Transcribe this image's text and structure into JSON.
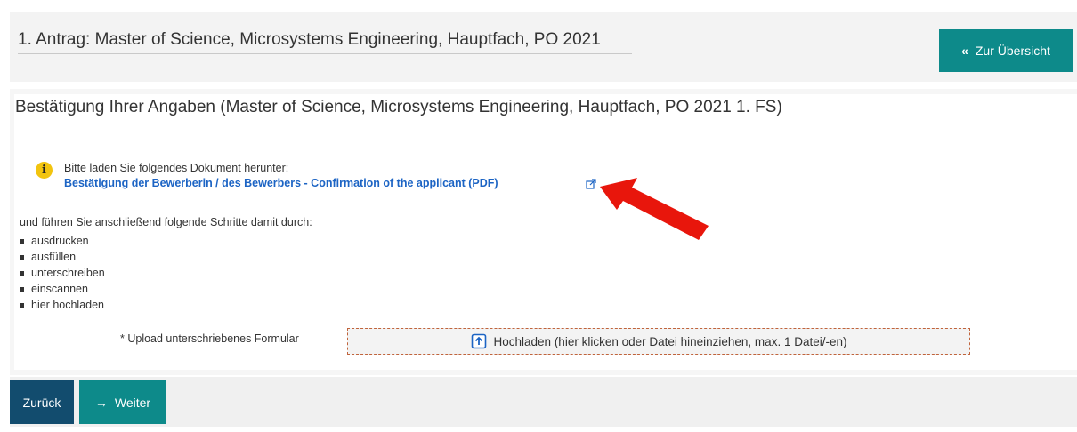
{
  "header": {
    "title": "1. Antrag: Master of Science, Microsystems Engineering, Hauptfach, PO 2021",
    "overview_button": "Zur Übersicht",
    "overview_icon": "«"
  },
  "section": {
    "title": "Bestätigung Ihrer Angaben (Master of Science, Microsystems Engineering, Hauptfach, PO 2021 1. FS)",
    "info_icon": "i",
    "info_text": "Bitte laden Sie folgendes Dokument herunter:",
    "document_link": "Bestätigung der Bewerberin / des Bewerbers - Confirmation of the applicant (PDF)",
    "steps_intro": "und führen Sie anschließend folgende Schritte damit durch:",
    "steps": [
      "ausdrucken",
      "ausfüllen",
      "unterschreiben",
      "einscannen",
      "hier hochladen"
    ],
    "upload_label": "* Upload unterschriebenes Formular",
    "upload_text": "Hochladen (hier klicken oder Datei hineinziehen, max. 1 Datei/-en)"
  },
  "footer": {
    "back_button": "Zurück",
    "next_button": "Weiter",
    "next_icon": "→"
  },
  "colors": {
    "teal": "#0d8a8a",
    "navy": "#124c6e",
    "link": "#1c64c4",
    "info": "#f2c40f",
    "arrow": "#e8160c"
  }
}
